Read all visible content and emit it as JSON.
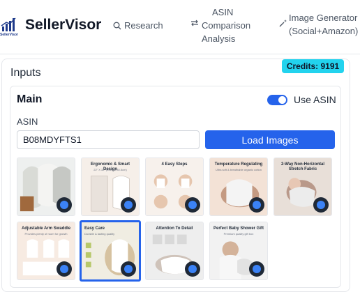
{
  "app": {
    "brand": "SellerVisor",
    "logo_text": "SellerVisor"
  },
  "nav": {
    "research": "Research",
    "asin_line1": "ASIN",
    "asin_line2": "Comparison",
    "asin_line3": "Analysis",
    "image_line1": "Image Generator",
    "image_line2": "(Social+Amazon)"
  },
  "inputs": {
    "title": "Inputs",
    "credits": "Credits: 9191",
    "main_title": "Main",
    "use_asin_label": "Use ASIN",
    "use_asin_enabled": true,
    "asin_label": "ASIN",
    "asin_value": "B08MDYFTS1",
    "load_button": "Load Images"
  },
  "thumbnails": [
    {
      "caption": "",
      "sub": "",
      "selected": false
    },
    {
      "caption": "Ergonomic & Smart Design",
      "sub": "22\" X 32\" (55cm x 80.5cm)",
      "selected": false
    },
    {
      "caption": "4 Easy Steps",
      "sub": "",
      "selected": false
    },
    {
      "caption": "Temperature Regulating",
      "sub": "Ultra soft & breathable organic cotton",
      "selected": false
    },
    {
      "caption": "2-Way Non-Horizontal Stretch Fabric",
      "sub": "",
      "selected": false
    },
    {
      "caption": "Adjustable Arm Swaddle",
      "sub": "Provides plenty of room for growth",
      "selected": false
    },
    {
      "caption": "Easy Care",
      "sub": "Durable & lasting quality",
      "selected": true
    },
    {
      "caption": "Attention To Detail",
      "sub": "",
      "selected": false
    },
    {
      "caption": "Perfect Baby Shower Gift",
      "sub": "Premium quality gift box",
      "selected": false
    }
  ],
  "colors": {
    "accent": "#2563eb",
    "credits_bg": "#22d3ee",
    "border": "#e5e7eb"
  }
}
